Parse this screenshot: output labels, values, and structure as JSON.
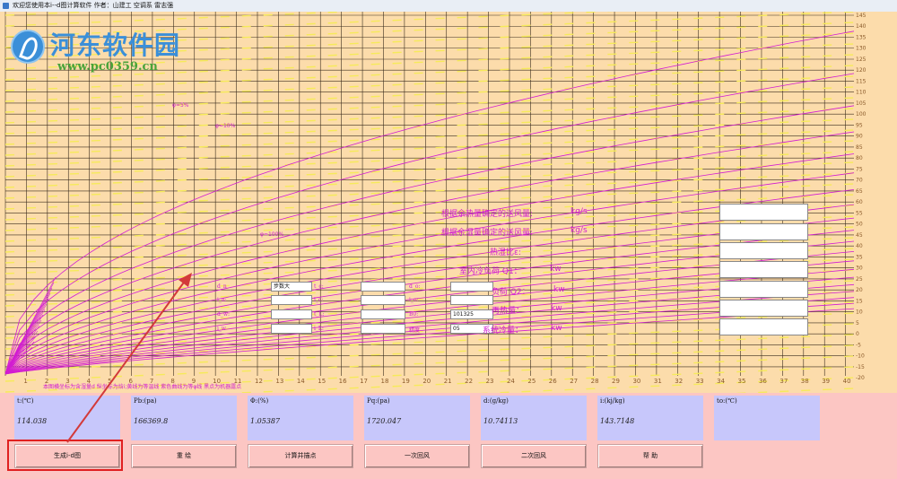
{
  "window": {
    "title": "欢迎您使用本i--d图计算软件    作者：山建工 空调系 雷志强"
  },
  "watermark": {
    "name": "河东软件园",
    "url": "www.pc0359.cn"
  },
  "chart": {
    "x_ticks": [
      "1",
      "2",
      "3",
      "4",
      "5",
      "6",
      "7",
      "8",
      "9",
      "10",
      "11",
      "12",
      "13",
      "14",
      "15",
      "16",
      "17",
      "18",
      "19",
      "20",
      "21",
      "22",
      "23",
      "24",
      "25",
      "26",
      "27",
      "28",
      "29",
      "30",
      "31",
      "32",
      "33",
      "34",
      "35",
      "36",
      "37",
      "38",
      "39",
      "40"
    ],
    "y_ticks": [
      "145",
      "140",
      "135",
      "130",
      "125",
      "120",
      "115",
      "110",
      "105",
      "100",
      "95",
      "90",
      "85",
      "80",
      "75",
      "70",
      "65",
      "60",
      "55",
      "50",
      "45",
      "40",
      "35",
      "30",
      "25",
      "20",
      "15",
      "10",
      "5",
      "0",
      "-5",
      "-10",
      "-15",
      "-20"
    ],
    "curve_labels": [
      "φ=5%",
      "φ=10%",
      "φ=100%"
    ],
    "note": "本图横坐标为含湿量d 纵坐标为焓i;黄线为等温线 紫色曲线为等φ线  黑点为机器露点"
  },
  "inputs": {
    "left_labels": [
      "d_n",
      "i_n:",
      "d_w:",
      "i_w"
    ],
    "col1": [
      "步数大",
      "",
      "",
      ""
    ],
    "mid_labels": [
      "t_c:",
      "i_c:",
      "t_L:",
      "i_L:"
    ],
    "col2": [
      "",
      "",
      "",
      ""
    ],
    "right_labels": [
      "d_o:",
      "i_o:",
      "B0:",
      "精度"
    ],
    "col3": [
      "",
      "",
      "101325",
      "05"
    ]
  },
  "results": {
    "rows": [
      {
        "label": "根据余热量确定的送风量:",
        "unit": "kg/s"
      },
      {
        "label": "根据余湿量确定的送风量:",
        "unit": "kg/s"
      },
      {
        "label": "热湿比ε:",
        "unit": ""
      },
      {
        "label": "室内冷负荷 Q1：",
        "unit": "kw"
      },
      {
        "label": "负荷 Q2：",
        "unit": "kw"
      },
      {
        "label": "再热量：",
        "unit": "kw"
      },
      {
        "label": "系统冷量：",
        "unit": "kw"
      }
    ]
  },
  "params": [
    {
      "label": "t:(℃)",
      "value": "114.038"
    },
    {
      "label": "Pb:(pa)",
      "value": "166369.8"
    },
    {
      "label": "Φ:(%)",
      "value": "1.05387"
    },
    {
      "label": "Pq:(pa)",
      "value": "1720.047"
    },
    {
      "label": "d:(g/kg)",
      "value": "10.74113"
    },
    {
      "label": "i:(kj/kg)",
      "value": "143.7148"
    },
    {
      "label": "to:(℃)",
      "value": ""
    }
  ],
  "buttons": [
    "生成i-d图",
    "重  绘",
    "计算并描点",
    "一次回风",
    "二次回风",
    "帮  助"
  ],
  "colors": {
    "chart_bg": "#fcdcab",
    "grid": "#3a2d1e",
    "isotherm": "#f6ea5a",
    "rh_curve": "#d21cd2",
    "panel": "#fcc6c3",
    "param_box": "#c7c7fb",
    "arrow": "#d33a3a"
  }
}
